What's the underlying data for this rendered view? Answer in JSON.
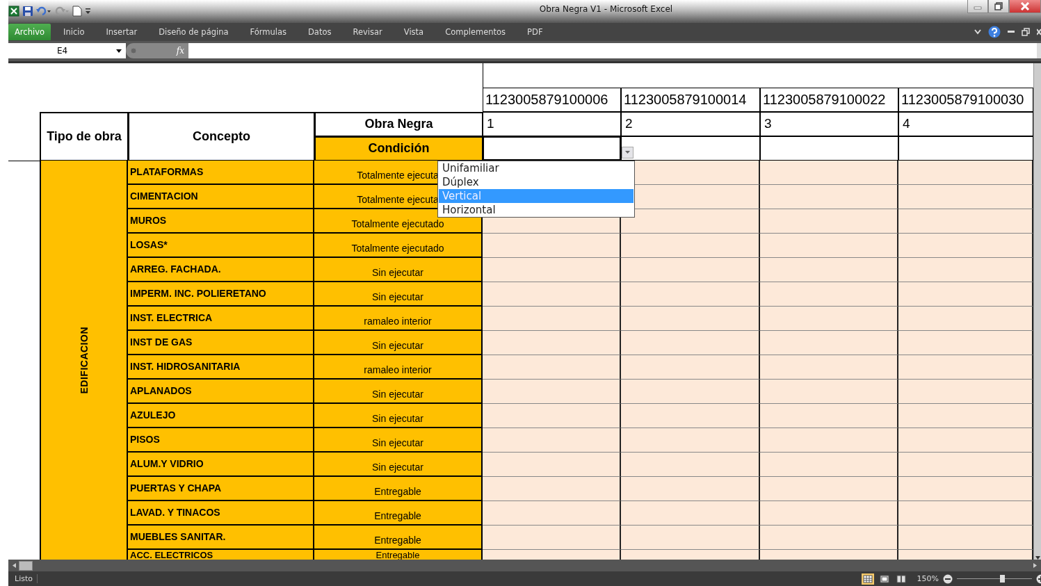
{
  "window": {
    "title": "Obra Negra V1  -  Microsoft Excel"
  },
  "ribbon_tabs": [
    {
      "label": "Archivo",
      "selected": true
    },
    {
      "label": "Inicio",
      "selected": false
    },
    {
      "label": "Insertar",
      "selected": false
    },
    {
      "label": "Diseño de página",
      "selected": false
    },
    {
      "label": "Fórmulas",
      "selected": false
    },
    {
      "label": "Datos",
      "selected": false
    },
    {
      "label": "Revisar",
      "selected": false
    },
    {
      "label": "Vista",
      "selected": false
    },
    {
      "label": "Complementos",
      "selected": false
    },
    {
      "label": "PDF",
      "selected": false
    }
  ],
  "formula_bar": {
    "name_box": "E4",
    "fx": "fx"
  },
  "sheet": {
    "column_codes": [
      "1123005879100006",
      "1123005879100014",
      "1123005879100022",
      "1123005879100030"
    ],
    "column_numbers": [
      "1",
      "2",
      "3",
      "4"
    ],
    "headers": {
      "tipo": "Tipo de obra",
      "concepto": "Concepto",
      "obra": "Obra Negra",
      "condicion": "Condición"
    },
    "group_label": "EDIFICACION",
    "rows": [
      {
        "concepto": "PLATAFORMAS",
        "condicion": "Totalmente ejecuta"
      },
      {
        "concepto": "CIMENTACION",
        "condicion": "Totalmente ejecuta"
      },
      {
        "concepto": "MUROS",
        "condicion": "Totalmente ejecutado"
      },
      {
        "concepto": "LOSAS*",
        "condicion": "Totalmente ejecutado"
      },
      {
        "concepto": "ARREG. FACHADA.",
        "condicion": "Sin ejecutar"
      },
      {
        "concepto": "IMPERM. INC. POLIERETANO",
        "condicion": "Sin ejecutar"
      },
      {
        "concepto": "INST. ELECTRICA",
        "condicion": "ramaleo interior"
      },
      {
        "concepto": "INST DE GAS",
        "condicion": "Sin ejecutar"
      },
      {
        "concepto": "INST. HIDROSANITARIA",
        "condicion": "ramaleo interior"
      },
      {
        "concepto": "APLANADOS",
        "condicion": "Sin ejecutar"
      },
      {
        "concepto": "AZULEJO",
        "condicion": "Sin ejecutar"
      },
      {
        "concepto": "PISOS",
        "condicion": "Sin ejecutar"
      },
      {
        "concepto": "ALUM.Y VIDRIO",
        "condicion": "Sin ejecutar"
      },
      {
        "concepto": "PUERTAS Y CHAPA",
        "condicion": "Entregable"
      },
      {
        "concepto": "LAVAD. Y TINACOS",
        "condicion": "Entregable"
      },
      {
        "concepto": "MUEBLES SANITAR.",
        "condicion": "Entregable"
      },
      {
        "concepto": "ACC. ELECTRICOS",
        "condicion": "Entregable"
      }
    ]
  },
  "dropdown": {
    "items": [
      {
        "label": "Unifamiliar",
        "selected": false
      },
      {
        "label": "Dúplex",
        "selected": false
      },
      {
        "label": "Vertical",
        "selected": true
      },
      {
        "label": "Horizontal",
        "selected": false
      }
    ]
  },
  "status_bar": {
    "status": "Listo",
    "views": [
      {
        "kind": "normal",
        "selected": true
      },
      {
        "kind": "layout",
        "selected": false
      },
      {
        "kind": "pagebreak",
        "selected": false
      }
    ],
    "zoom": "150%",
    "zoom_slider": {
      "level": 0.6
    }
  }
}
